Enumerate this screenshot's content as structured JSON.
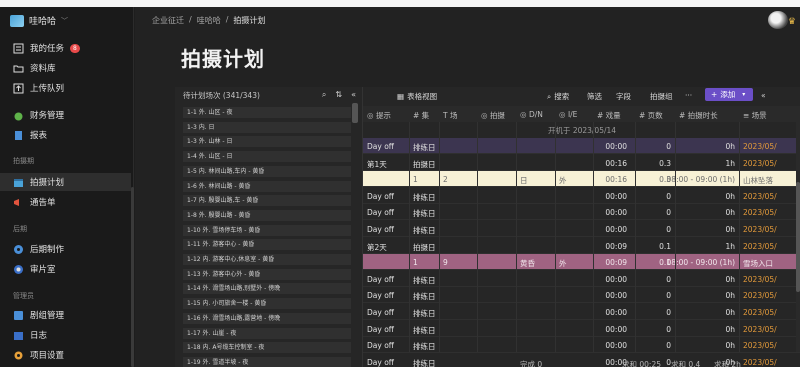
{
  "workspace": {
    "name": "哇哈哈"
  },
  "nav": {
    "items_top": [
      {
        "label": "我的任务",
        "badge": "8"
      },
      {
        "label": "资料库"
      },
      {
        "label": "上传队列"
      },
      {
        "label": "财务管理"
      },
      {
        "label": "报表"
      }
    ],
    "section_shoot": "拍摄期",
    "items_shoot": [
      {
        "label": "拍摄计划"
      },
      {
        "label": "通告单"
      }
    ],
    "section_post": "后期",
    "items_post": [
      {
        "label": "后期制作"
      },
      {
        "label": "审片室"
      }
    ],
    "section_manage": "管理员",
    "items_manage": [
      {
        "label": "剧组管理"
      },
      {
        "label": "日志"
      },
      {
        "label": "项目设置"
      }
    ]
  },
  "breadcrumb": [
    "企业征迁",
    "哇哈哈",
    "拍摄计划"
  ],
  "page_title": "拍摄计划",
  "left_panel": {
    "title": "待计划场次 (341/343)",
    "scenes": [
      "1-1 外. 山区 - 夜",
      "1-3 内. 日",
      "1-3 外. 山林 - 日",
      "1-4 外. 山区 - 日",
      "1-5 内. 林间山路,车内 - 黄昏",
      "1-6 外. 林间山路 - 黄昏",
      "1-7 内. 殷婴山路,车 - 黄昏",
      "1-8 外. 殷婴山路 - 黄昏",
      "1-10 外. 雪场停车场 - 黄昏",
      "1-11 外. 游客中心 - 黄昏",
      "1-12 内. 游客中心,休息室 - 黄昏",
      "1-13 外. 游客中心外 - 黄昏",
      "1-14 外. 滑雪场山路,别墅外 - 傍晚",
      "1-15 内. 小司旅舍一楼 - 黄昏",
      "1-16 外. 滑雪场山路,露营地 - 傍晚",
      "1-17 外. 山崖 - 夜",
      "1-18 内. A号缆车控制室 - 夜",
      "1-19 外. 雪道半坡 - 夜"
    ]
  },
  "toolbar": {
    "view": "表格视图",
    "search": "搜索",
    "filter": "筛选",
    "fields": "字段",
    "group": "拍摄组",
    "more": "···",
    "add": "添加"
  },
  "columns": [
    "提示",
    "集",
    "场",
    "拍摄",
    "D/N",
    "I/E",
    "戏量",
    "页数",
    "拍摄时长",
    "场景"
  ],
  "group_label": "开机于 2023/05/14",
  "rows": [
    {
      "c0": "Day off",
      "c1": "排练日",
      "c2": "",
      "c4": "",
      "c5": "",
      "c6": "00:00",
      "c7": "0",
      "c8": "0h",
      "c9": "2023/05/",
      "style": "hl"
    },
    {
      "c0": "第1天",
      "c1": "拍摄日",
      "c2": "",
      "c4": "",
      "c5": "",
      "c6": "00:16",
      "c7": "0.3",
      "c8": "1h",
      "c9": "2023/05/",
      "style": ""
    },
    {
      "c0": "",
      "c1": "1",
      "c2": "2",
      "c4": "日",
      "c5": "外",
      "c6": "00:16",
      "c7": "0.3",
      "c8": "08:00 - 09:00 (1h)",
      "c9": "山林坠落",
      "style": "cream"
    },
    {
      "c0": "Day off",
      "c1": "排练日",
      "c2": "",
      "c4": "",
      "c5": "",
      "c6": "00:00",
      "c7": "0",
      "c8": "0h",
      "c9": "2023/05/",
      "style": ""
    },
    {
      "c0": "Day off",
      "c1": "排练日",
      "c2": "",
      "c4": "",
      "c5": "",
      "c6": "00:00",
      "c7": "0",
      "c8": "0h",
      "c9": "2023/05/",
      "style": ""
    },
    {
      "c0": "Day off",
      "c1": "排练日",
      "c2": "",
      "c4": "",
      "c5": "",
      "c6": "00:00",
      "c7": "0",
      "c8": "0h",
      "c9": "2023/05/",
      "style": ""
    },
    {
      "c0": "第2天",
      "c1": "拍摄日",
      "c2": "",
      "c4": "",
      "c5": "",
      "c6": "00:09",
      "c7": "0.1",
      "c8": "1h",
      "c9": "2023/05/",
      "style": ""
    },
    {
      "c0": "",
      "c1": "1",
      "c2": "9",
      "c4": "黄昏",
      "c5": "外",
      "c6": "00:09",
      "c7": "0.1",
      "c8": "08:00 - 09:00 (1h)",
      "c9": "雪场入口",
      "style": "mauve"
    },
    {
      "c0": "Day off",
      "c1": "排练日",
      "c2": "",
      "c4": "",
      "c5": "",
      "c6": "00:00",
      "c7": "0",
      "c8": "0h",
      "c9": "2023/05/",
      "style": ""
    },
    {
      "c0": "Day off",
      "c1": "排练日",
      "c2": "",
      "c4": "",
      "c5": "",
      "c6": "00:00",
      "c7": "0",
      "c8": "0h",
      "c9": "2023/05/",
      "style": ""
    },
    {
      "c0": "Day off",
      "c1": "排练日",
      "c2": "",
      "c4": "",
      "c5": "",
      "c6": "00:00",
      "c7": "0",
      "c8": "0h",
      "c9": "2023/05/",
      "style": ""
    },
    {
      "c0": "Day off",
      "c1": "排练日",
      "c2": "",
      "c4": "",
      "c5": "",
      "c6": "00:00",
      "c7": "0",
      "c8": "0h",
      "c9": "2023/05/",
      "style": ""
    },
    {
      "c0": "Day off",
      "c1": "排练日",
      "c2": "",
      "c4": "",
      "c5": "",
      "c6": "00:00",
      "c7": "0",
      "c8": "0h",
      "c9": "2023/05/",
      "style": ""
    },
    {
      "c0": "Day off",
      "c1": "排练日",
      "c2": "",
      "c4": "",
      "c5": "",
      "c6": "00:00",
      "c7": "0",
      "c8": "0h",
      "c9": "2023/05/",
      "style": ""
    }
  ],
  "footer": {
    "done": "完成 0",
    "sum_time": "求和 00:25",
    "sum_pages": "求和 0.4",
    "sum_hours": "求和 2h"
  }
}
